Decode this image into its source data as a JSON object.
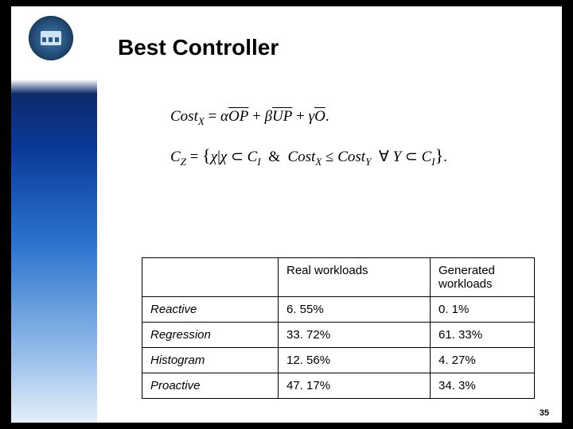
{
  "title": "Best Controller",
  "formula1_html": "<span class='it'>Cost</span><span class='sub it'>X</span> = <span class='it'>α</span><span class='bar it'>OP</span> + <span class='it'>β</span><span class='bar it'>UP</span> + <span class='it'>γ</span><span class='bar it'>O</span>.",
  "formula2_html": "<span class='it'>C</span><span class='sub it'>Z</span> = <span class='bigbrace'>{</span><span class='it'>χ</span>|<span class='it'>χ</span> ⊂ <span class='it'>C</span><span class='sub it'>I</span> &nbsp;&amp;&nbsp; <span class='it'>Cost</span><span class='sub it'>X</span> ≤ <span class='it'>Cost</span><span class='sub it'>Y</span> &nbsp;∀&nbsp;<span class='it'>Y</span> ⊂ <span class='it'>C</span><span class='sub it'>I</span><span class='bigbrace'>}</span>.",
  "columns": [
    "Real workloads",
    "Generated workloads"
  ],
  "rows": [
    {
      "name": "Reactive",
      "real": "6. 55%",
      "gen": "0. 1%"
    },
    {
      "name": "Regression",
      "real": "33. 72%",
      "gen": "61. 33%"
    },
    {
      "name": "Histogram",
      "real": "12. 56%",
      "gen": "4. 27%"
    },
    {
      "name": "Proactive",
      "real": "47. 17%",
      "gen": "34. 3%"
    }
  ],
  "page_number": "35",
  "chart_data": {
    "type": "table",
    "title": "Best Controller",
    "columns": [
      "",
      "Real workloads",
      "Generated workloads"
    ],
    "rows": [
      [
        "Reactive",
        6.55,
        0.1
      ],
      [
        "Regression",
        33.72,
        61.33
      ],
      [
        "Histogram",
        12.56,
        4.27
      ],
      [
        "Proactive",
        47.17,
        34.3
      ]
    ],
    "unit": "%"
  }
}
